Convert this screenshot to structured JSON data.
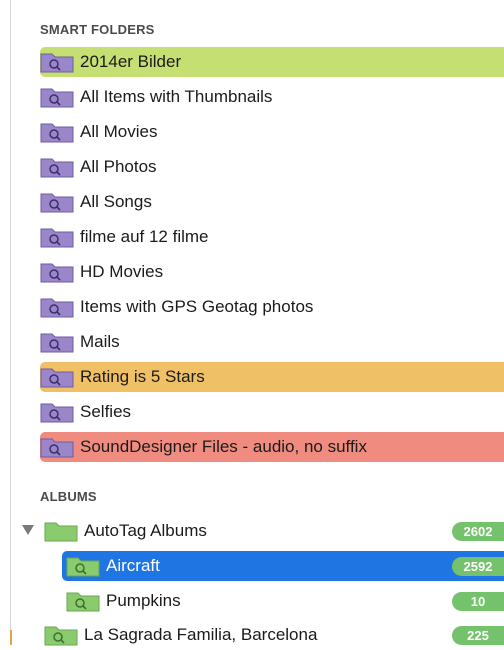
{
  "sections": {
    "smart_header": "SMART FOLDERS",
    "albums_header": "ALBUMS"
  },
  "colors": {
    "green_highlight": "#c6df73",
    "orange_highlight": "#f0c067",
    "red_highlight": "#f08b7f",
    "selection_blue": "#1f76e3",
    "badge_green": "#74c26b",
    "smart_folder_icon": "#9a86c8",
    "album_folder_icon": "#8acb6e"
  },
  "smart_folders": [
    {
      "label": "2014er Bilder",
      "highlight": "green"
    },
    {
      "label": "All Items with Thumbnails",
      "highlight": ""
    },
    {
      "label": "All Movies",
      "highlight": ""
    },
    {
      "label": "All Photos",
      "highlight": ""
    },
    {
      "label": "All Songs",
      "highlight": ""
    },
    {
      "label": "filme auf 12 filme",
      "highlight": ""
    },
    {
      "label": "HD Movies",
      "highlight": ""
    },
    {
      "label": "Items with GPS Geotag photos",
      "highlight": ""
    },
    {
      "label": "Mails",
      "highlight": ""
    },
    {
      "label": "Rating is 5 Stars",
      "highlight": "orange"
    },
    {
      "label": "Selfies",
      "highlight": ""
    },
    {
      "label": "SoundDesigner Files - audio, no suffix",
      "highlight": "red"
    }
  ],
  "albums": [
    {
      "label": "AutoTag Albums",
      "count": "2602",
      "expanded": true
    },
    {
      "label": "Aircraft",
      "count": "2592",
      "selected": true
    },
    {
      "label": "Pumpkins",
      "count": "10"
    },
    {
      "label": "La Sagrada Familia, Barcelona",
      "count": "225"
    }
  ]
}
